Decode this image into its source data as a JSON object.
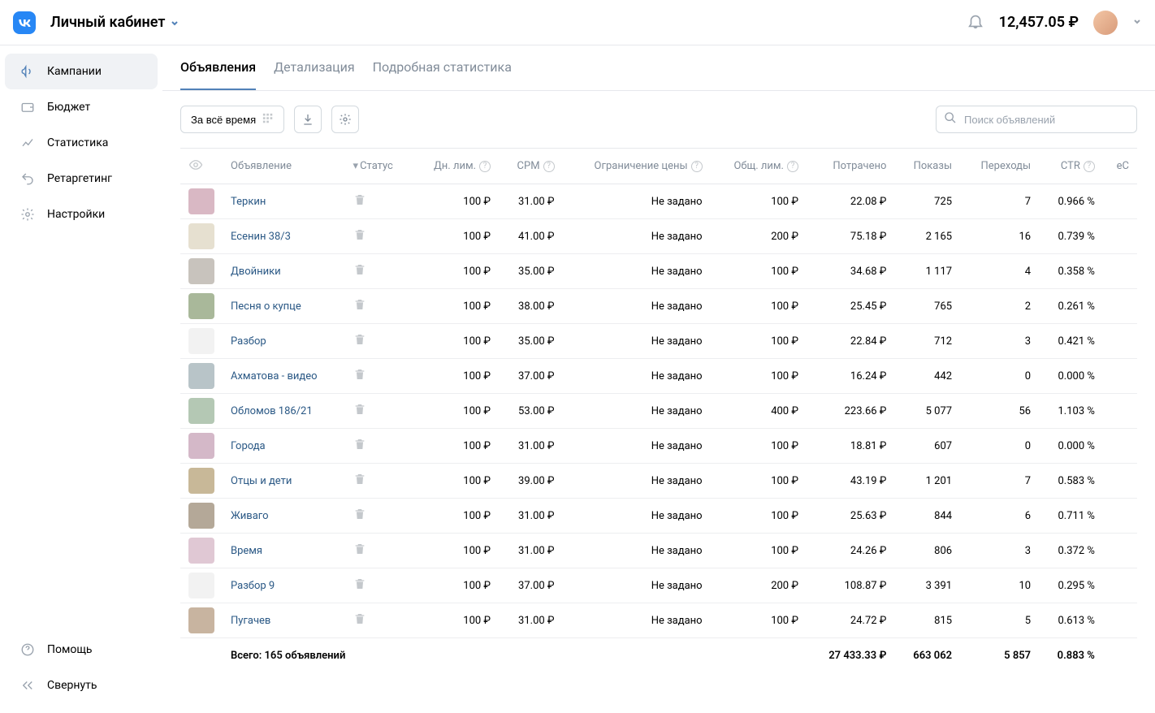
{
  "header": {
    "title": "Личный кабинет",
    "balance": "12,457.05 ₽"
  },
  "sidebar": {
    "items": [
      {
        "label": "Кампании"
      },
      {
        "label": "Бюджет"
      },
      {
        "label": "Статистика"
      },
      {
        "label": "Ретаргетинг"
      },
      {
        "label": "Настройки"
      }
    ],
    "bottom": [
      {
        "label": "Помощь"
      },
      {
        "label": "Свернуть"
      }
    ]
  },
  "tabs": {
    "items": [
      {
        "label": "Объявления"
      },
      {
        "label": "Детализация"
      },
      {
        "label": "Подробная статистика"
      }
    ]
  },
  "toolbar": {
    "period": "За всё время",
    "search_placeholder": "Поиск объявлений"
  },
  "table": {
    "headers": {
      "ad": "Объявление",
      "status": "Статус",
      "daily_limit": "Дн. лим.",
      "cpm": "CPM",
      "price_limit": "Ограничение цены",
      "total_limit": "Общ. лим.",
      "spent": "Потрачено",
      "impressions": "Показы",
      "clicks": "Переходы",
      "ctr": "CTR",
      "ecpc": "eC"
    },
    "rows": [
      {
        "name": "Теркин",
        "daily": "100 ₽",
        "cpm": "31.00 ₽",
        "limit": "Не задано",
        "total": "100 ₽",
        "spent": "22.08 ₽",
        "imp": "725",
        "clk": "7",
        "ctr": "0.966 %",
        "thumb": "#d9b8c4"
      },
      {
        "name": "Есенин 38/3",
        "daily": "100 ₽",
        "cpm": "41.00 ₽",
        "limit": "Не задано",
        "total": "200 ₽",
        "spent": "75.18 ₽",
        "imp": "2 165",
        "clk": "16",
        "ctr": "0.739 %",
        "thumb": "#e6e0d0"
      },
      {
        "name": "Двойники",
        "daily": "100 ₽",
        "cpm": "35.00 ₽",
        "limit": "Не задано",
        "total": "100 ₽",
        "spent": "34.68 ₽",
        "imp": "1 117",
        "clk": "4",
        "ctr": "0.358 %",
        "thumb": "#c8c3bd"
      },
      {
        "name": "Песня о купце",
        "daily": "100 ₽",
        "cpm": "38.00 ₽",
        "limit": "Не задано",
        "total": "100 ₽",
        "spent": "25.45 ₽",
        "imp": "765",
        "clk": "2",
        "ctr": "0.261 %",
        "thumb": "#a9b89a"
      },
      {
        "name": "Разбор",
        "daily": "100 ₽",
        "cpm": "35.00 ₽",
        "limit": "Не задано",
        "total": "100 ₽",
        "spent": "22.84 ₽",
        "imp": "712",
        "clk": "3",
        "ctr": "0.421 %",
        "thumb": "#f2f2f2"
      },
      {
        "name": "Ахматова - видео",
        "daily": "100 ₽",
        "cpm": "37.00 ₽",
        "limit": "Не задано",
        "total": "100 ₽",
        "spent": "16.24 ₽",
        "imp": "442",
        "clk": "0",
        "ctr": "0.000 %",
        "thumb": "#b8c4c8"
      },
      {
        "name": "Обломов 186/21",
        "daily": "100 ₽",
        "cpm": "53.00 ₽",
        "limit": "Не задано",
        "total": "400 ₽",
        "spent": "223.66 ₽",
        "imp": "5 077",
        "clk": "56",
        "ctr": "1.103 %",
        "thumb": "#b4c8b4"
      },
      {
        "name": "Города",
        "daily": "100 ₽",
        "cpm": "31.00 ₽",
        "limit": "Не задано",
        "total": "100 ₽",
        "spent": "18.81 ₽",
        "imp": "607",
        "clk": "0",
        "ctr": "0.000 %",
        "thumb": "#d4b8c8"
      },
      {
        "name": "Отцы и дети",
        "daily": "100 ₽",
        "cpm": "39.00 ₽",
        "limit": "Не задано",
        "total": "100 ₽",
        "spent": "43.19 ₽",
        "imp": "1 201",
        "clk": "7",
        "ctr": "0.583 %",
        "thumb": "#c8b898"
      },
      {
        "name": "Живаго",
        "daily": "100 ₽",
        "cpm": "31.00 ₽",
        "limit": "Не задано",
        "total": "100 ₽",
        "spent": "25.63 ₽",
        "imp": "844",
        "clk": "6",
        "ctr": "0.711 %",
        "thumb": "#b4a898"
      },
      {
        "name": "Время",
        "daily": "100 ₽",
        "cpm": "31.00 ₽",
        "limit": "Не задано",
        "total": "100 ₽",
        "spent": "24.26 ₽",
        "imp": "806",
        "clk": "3",
        "ctr": "0.372 %",
        "thumb": "#e0c8d4"
      },
      {
        "name": "Разбор 9",
        "daily": "100 ₽",
        "cpm": "37.00 ₽",
        "limit": "Не задано",
        "total": "200 ₽",
        "spent": "108.87 ₽",
        "imp": "3 391",
        "clk": "10",
        "ctr": "0.295 %",
        "thumb": "#f2f2f2"
      },
      {
        "name": "Пугачев",
        "daily": "100 ₽",
        "cpm": "31.00 ₽",
        "limit": "Не задано",
        "total": "100 ₽",
        "spent": "24.72 ₽",
        "imp": "815",
        "clk": "5",
        "ctr": "0.613 %",
        "thumb": "#c8b4a0"
      }
    ],
    "footer": {
      "total_label": "Всего: 165 объявлений",
      "spent": "27 433.33 ₽",
      "imp": "663 062",
      "clk": "5 857",
      "ctr": "0.883 %"
    }
  }
}
